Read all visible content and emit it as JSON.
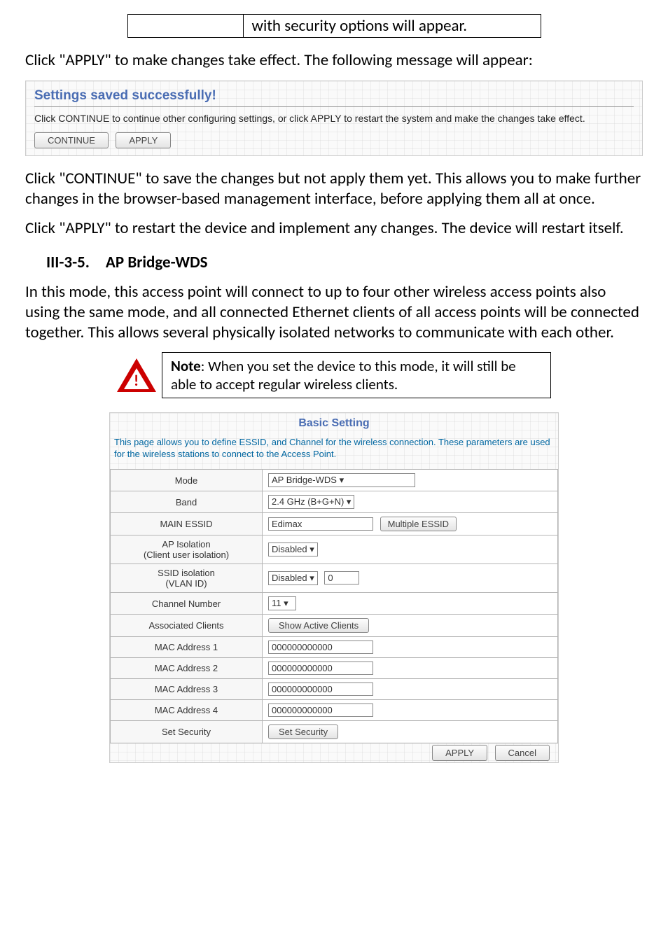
{
  "top_table": {
    "cell2": "with security options will appear."
  },
  "para1": "Click \"APPLY\" to make changes take effect. The following message will appear:",
  "settings_panel": {
    "title": "Settings saved successfully!",
    "desc": "Click CONTINUE to continue other configuring settings, or click APPLY to restart the system and make the changes take effect.",
    "btn_continue": "CONTINUE",
    "btn_apply": "APPLY"
  },
  "para2": "Click \"CONTINUE\" to save the changes but not apply them yet. This allows you to make further changes in the browser-based management interface, before applying them all at once.",
  "para3": "Click \"APPLY\" to restart the device and implement any changes. The device will restart itself.",
  "section_heading": "III-3-5. AP Bridge-WDS",
  "para4": "In this mode, this access point will connect to up to four other wireless access points also using the same mode, and all connected Ethernet clients of all access points will be connected together. This allows several physically isolated networks to communicate with each other.",
  "note": {
    "label": "Note",
    "text": ": When you set the device to this mode, it will still be able to accept regular wireless clients."
  },
  "basic": {
    "title": "Basic Setting",
    "desc": "This page allows you to define ESSID, and Channel for the wireless connection. These parameters are used for the wireless stations to connect to the Access Point.",
    "rows": {
      "mode": {
        "label": "Mode",
        "value": "AP Bridge-WDS"
      },
      "band": {
        "label": "Band",
        "value": "2.4 GHz (B+G+N)"
      },
      "essid": {
        "label": "MAIN ESSID",
        "value": "Edimax",
        "btn": "Multiple ESSID"
      },
      "apiso": {
        "label": "AP Isolation\n(Client user isolation)",
        "value": "Disabled"
      },
      "ssidiso": {
        "label": "SSID isolation\n(VLAN ID)",
        "value": "Disabled",
        "input": "0"
      },
      "channel": {
        "label": "Channel Number",
        "value": "11"
      },
      "assoc": {
        "label": "Associated Clients",
        "btn": "Show Active Clients"
      },
      "mac1": {
        "label": "MAC Address 1",
        "value": "000000000000"
      },
      "mac2": {
        "label": "MAC Address 2",
        "value": "000000000000"
      },
      "mac3": {
        "label": "MAC Address 3",
        "value": "000000000000"
      },
      "mac4": {
        "label": "MAC Address 4",
        "value": "000000000000"
      },
      "setsec": {
        "label": "Set Security",
        "btn": "Set Security"
      }
    },
    "apply": "APPLY",
    "cancel": "Cancel"
  }
}
